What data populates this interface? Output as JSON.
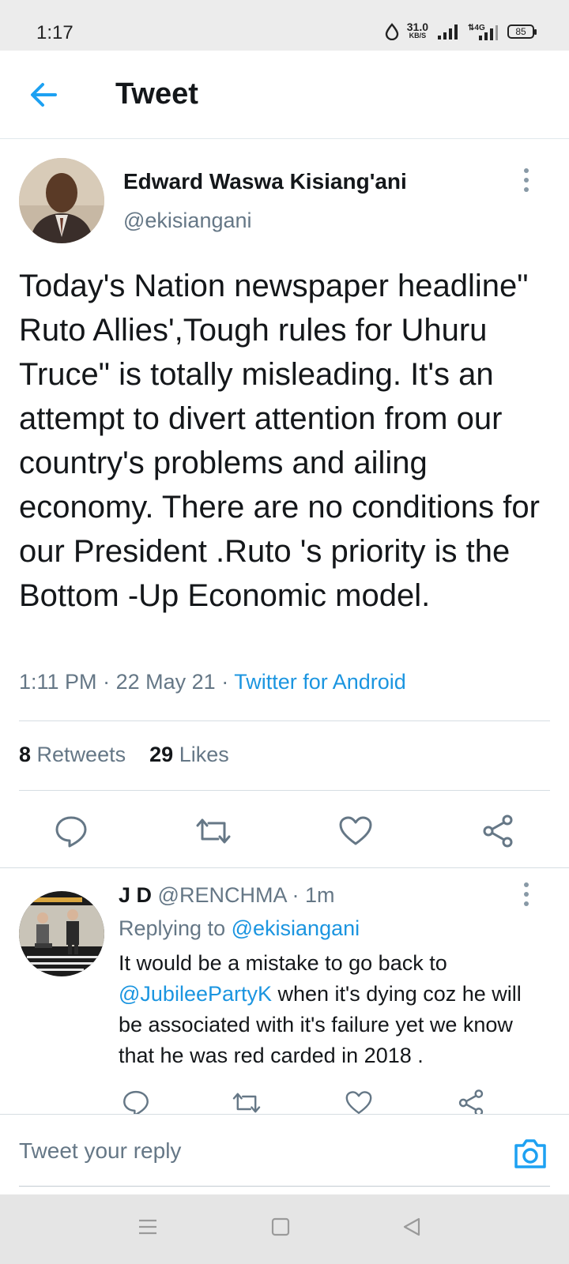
{
  "status_bar": {
    "time": "1:17",
    "net_speed": "31.0",
    "net_unit": "KB/S",
    "battery": "85"
  },
  "header": {
    "title": "Tweet"
  },
  "tweet": {
    "author_name": "Edward Waswa Kisiang'ani",
    "author_handle": "@ekisiangani",
    "text": "Today's Nation newspaper headline\" Ruto Allies',Tough rules for Uhuru Truce\" is totally misleading. It's an attempt to divert attention from our country's problems and ailing economy. There are no conditions  for our President .Ruto 's  priority is the Bottom -Up Economic model.",
    "time": "1:11 PM",
    "date": "22 May 21",
    "separator": "·",
    "source": "Twitter for Android",
    "retweets_count": "8",
    "retweets_label": "Retweets",
    "likes_count": "29",
    "likes_label": "Likes"
  },
  "reply": {
    "name": "J D",
    "handle": "@RENCHMA",
    "separator": "·",
    "age": "1m",
    "replying_label": "Replying to",
    "replying_handle": "@ekisiangani",
    "text_before": "It would be a mistake to go back to",
    "mention": "@JubileePartyK",
    "text_after": " when it's dying coz he will be associated with it's failure yet we know that he was red carded in 2018 ."
  },
  "compose": {
    "placeholder": "Tweet your reply"
  },
  "colors": {
    "accent": "#1da1f2",
    "link": "#1b95e0",
    "secondary_text": "#657786",
    "icon_gray": "#657786"
  },
  "icons": {
    "back": "arrow-left-icon",
    "more": "more-vertical-icon",
    "reply": "reply-icon",
    "retweet": "retweet-icon",
    "like": "heart-icon",
    "share": "share-icon",
    "camera": "camera-icon"
  }
}
